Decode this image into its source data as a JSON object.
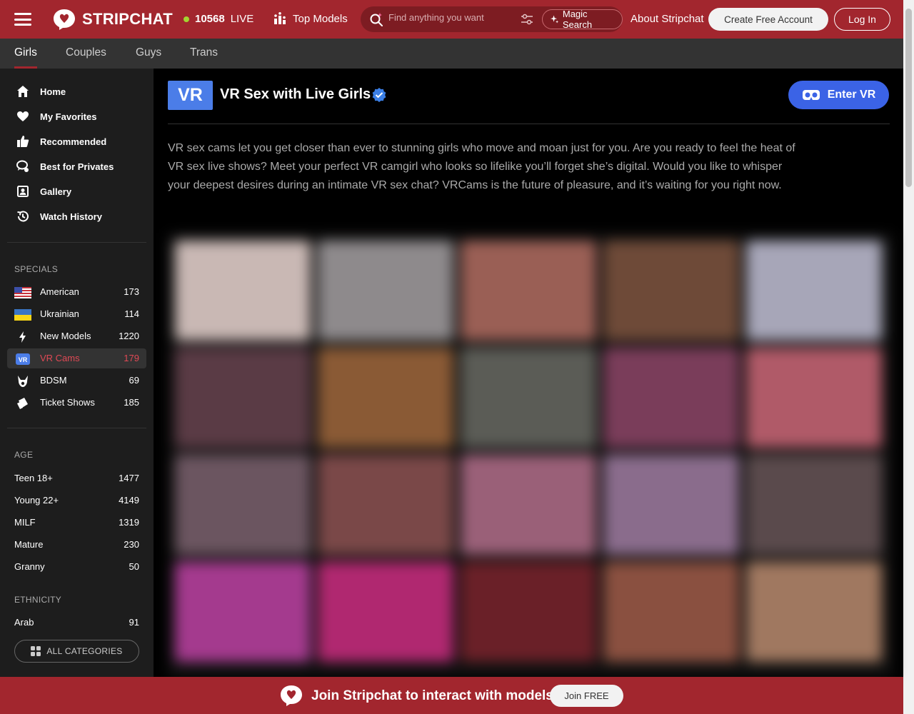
{
  "header": {
    "logo_text_bold": "STRIPCHAT",
    "live_count": "10568",
    "live_label": "LIVE",
    "top_models": "Top Models",
    "search_placeholder": "Find anything you want",
    "magic_search": "Magic Search",
    "about": "About Stripchat",
    "create_account": "Create Free Account",
    "login": "Log In"
  },
  "category_tabs": [
    {
      "label": "Girls",
      "active": true
    },
    {
      "label": "Couples",
      "active": false
    },
    {
      "label": "Guys",
      "active": false
    },
    {
      "label": "Trans",
      "active": false
    }
  ],
  "sidebar": {
    "nav": [
      {
        "label": "Home",
        "icon": "home-icon"
      },
      {
        "label": "My Favorites",
        "icon": "heart-icon"
      },
      {
        "label": "Recommended",
        "icon": "thumbs-up-icon"
      },
      {
        "label": "Best for Privates",
        "icon": "private-chat-icon"
      },
      {
        "label": "Gallery",
        "icon": "gallery-icon"
      },
      {
        "label": "Watch History",
        "icon": "history-icon"
      }
    ],
    "specials_label": "SPECIALS",
    "specials": [
      {
        "label": "American",
        "count": "173",
        "icon": "us-flag-icon"
      },
      {
        "label": "Ukrainian",
        "count": "114",
        "icon": "ua-flag-icon"
      },
      {
        "label": "New Models",
        "count": "1220",
        "icon": "lightning-icon"
      },
      {
        "label": "VR Cams",
        "count": "179",
        "icon": "vr-icon",
        "active": true
      },
      {
        "label": "BDSM",
        "count": "69",
        "icon": "bdsm-icon"
      },
      {
        "label": "Ticket Shows",
        "count": "185",
        "icon": "ticket-icon"
      }
    ],
    "age_label": "AGE",
    "age": [
      {
        "label": "Teen 18+",
        "count": "1477"
      },
      {
        "label": "Young 22+",
        "count": "4149"
      },
      {
        "label": "MILF",
        "count": "1319"
      },
      {
        "label": "Mature",
        "count": "230"
      },
      {
        "label": "Granny",
        "count": "50"
      }
    ],
    "ethnicity_label": "ETHNICITY",
    "ethnicity": [
      {
        "label": "Arab",
        "count": "91"
      }
    ],
    "all_categories": "ALL CATEGORIES"
  },
  "main": {
    "vr_badge": "VR",
    "title": "VR Sex with Live Girls",
    "enter_vr": "Enter VR",
    "description": "VR sex cams let you get closer than ever to stunning girls who move and moan just for you. Are you ready to feel the heat of VR sex live shows? Meet your perfect VR camgirl who looks so lifelike you’ll forget she’s digital. Would you like to whisper your deepest desires during an intimate VR sex chat? VRCams is the future of pleasure, and it’s waiting for you right now."
  },
  "footer_bar": {
    "text": "Join Stripchat to interact with models!",
    "join_button": "Join FREE"
  },
  "colors": {
    "brand_red": "#a2262e",
    "accent_blue": "#3b63e6",
    "live_green": "#a3d431",
    "active_red_text": "#e04955"
  }
}
